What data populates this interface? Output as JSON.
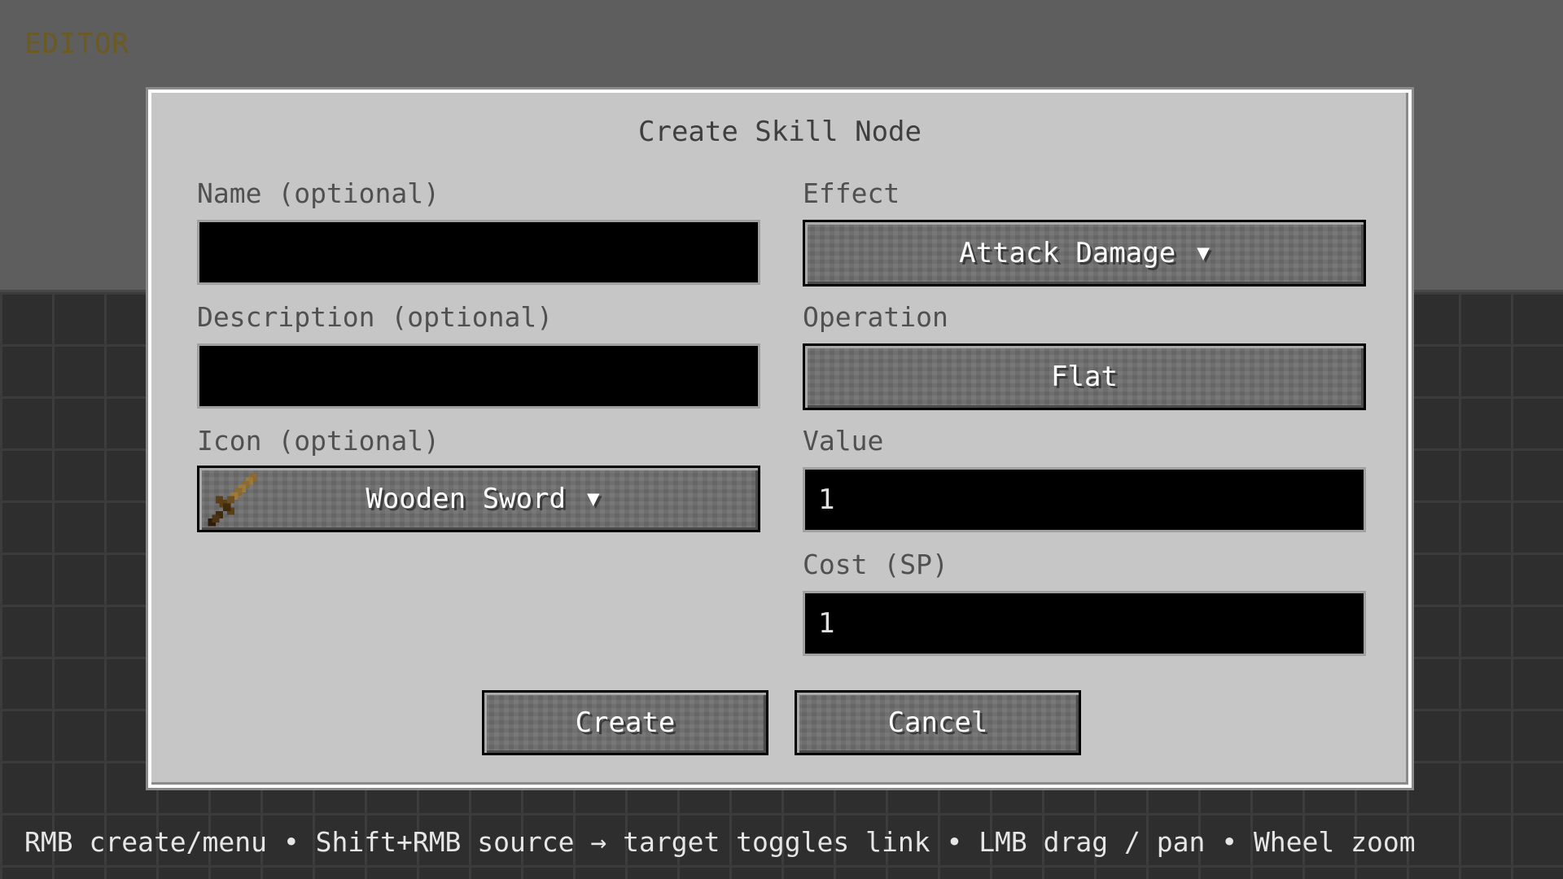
{
  "header": {
    "editor_label": "EDITOR"
  },
  "footer": {
    "hint": "RMB create/menu • Shift+RMB source → target toggles link • LMB drag / pan • Wheel zoom"
  },
  "dialog": {
    "title": "Create Skill Node",
    "name": {
      "label": "Name (optional)",
      "value": ""
    },
    "description": {
      "label": "Description (optional)",
      "value": ""
    },
    "icon": {
      "label": "Icon (optional)",
      "selected": "Wooden Sword",
      "icon_name": "wooden-sword-icon"
    },
    "effect": {
      "label": "Effect",
      "selected": "Attack Damage"
    },
    "operation": {
      "label": "Operation",
      "selected": "Flat"
    },
    "value": {
      "label": "Value",
      "value": "1"
    },
    "cost": {
      "label": "Cost (SP)",
      "value": "1"
    },
    "create_label": "Create",
    "cancel_label": "Cancel",
    "dropdown_arrow": "▼"
  },
  "colors": {
    "editor_label": "#6b5a22",
    "dialog_bg": "#c6c6c6",
    "button_bg": "#6f6f6f",
    "field_bg": "#000000"
  }
}
